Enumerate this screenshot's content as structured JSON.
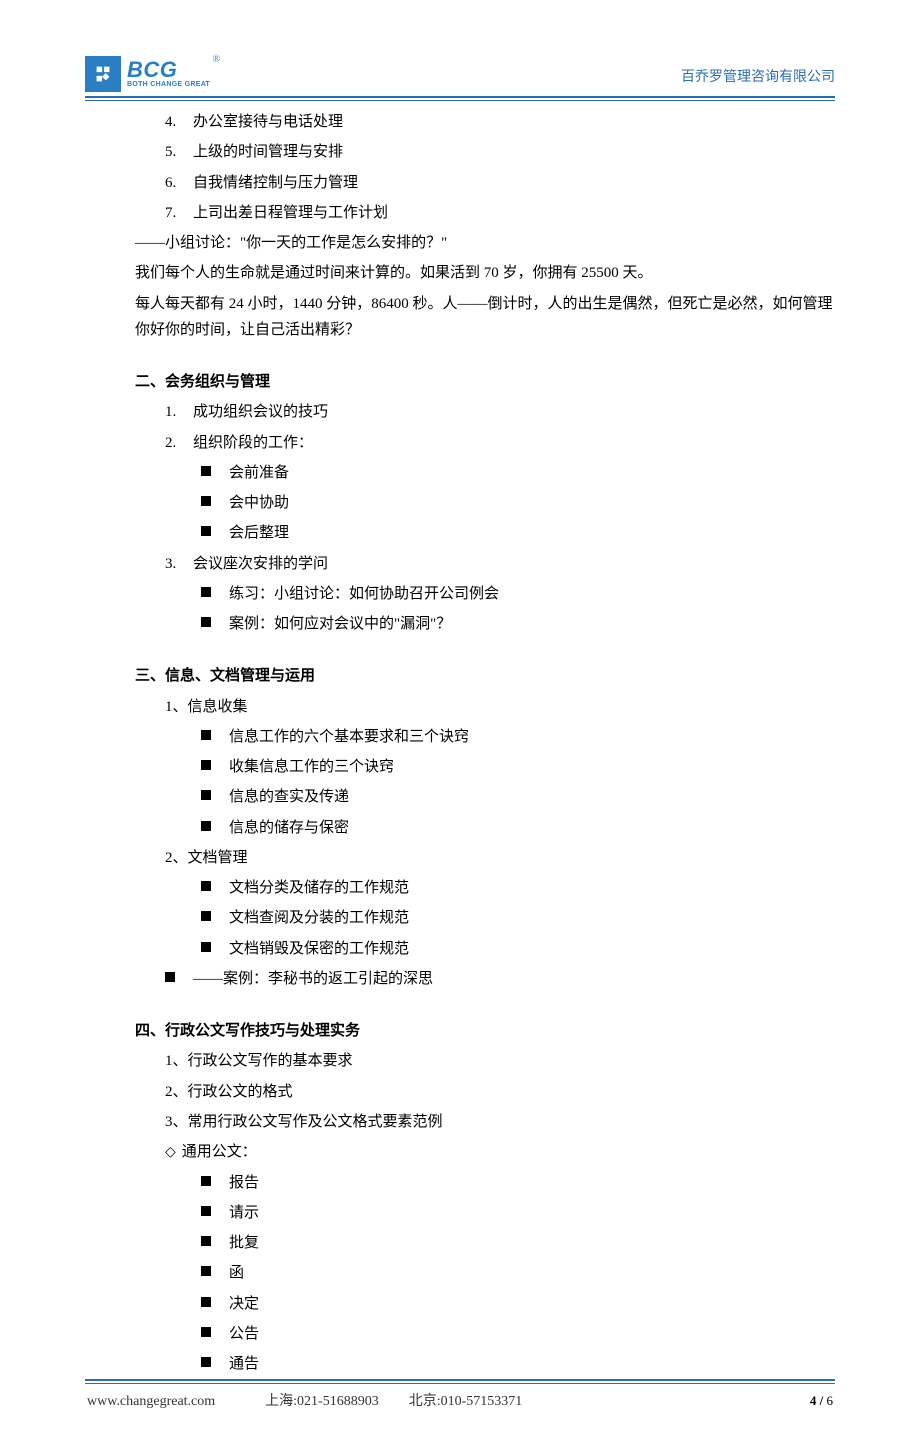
{
  "header": {
    "logo_text": "BCG",
    "logo_sub": "BOTH CHANGE GREAT",
    "logo_reg": "®",
    "company": "百乔罗管理咨询有限公司"
  },
  "section1": {
    "items": [
      "办公室接待与电话处理",
      "上级的时间管理与安排",
      "自我情绪控制与压力管理",
      "上司出差日程管理与工作计划"
    ],
    "para1": "——小组讨论：\"你一天的工作是怎么安排的？\"",
    "para2": "我们每个人的生命就是通过时间来计算的。如果活到 70 岁，你拥有 25500 天。",
    "para3": "每人每天都有 24 小时，1440 分钟，86400 秒。人——倒计时，人的出生是偶然，但死亡是必然，如何管理你好你的时间，让自己活出精彩？"
  },
  "section2": {
    "title": "二、会务组织与管理",
    "n1": "成功组织会议的技巧",
    "n2": "组织阶段的工作：",
    "sub2": [
      "会前准备",
      "会中协助",
      "会后整理"
    ],
    "n3": "会议座次安排的学问",
    "sub3": [
      "练习：小组讨论：如何协助召开公司例会",
      "案例：如何应对会议中的\"漏洞\"？"
    ]
  },
  "section3": {
    "title": "三、信息、文档管理与运用",
    "g1": "1、信息收集",
    "g1_items": [
      "信息工作的六个基本要求和三个诀窍",
      "收集信息工作的三个诀窍",
      "信息的查实及传递",
      "信息的储存与保密"
    ],
    "g2": "2、文档管理",
    "g2_items": [
      "文档分类及储存的工作规范",
      "文档查阅及分装的工作规范",
      "文档销毁及保密的工作规范"
    ],
    "case": "——案例：李秘书的返工引起的深思"
  },
  "section4": {
    "title": "四、行政公文写作技巧与处理实务",
    "n1": "1、行政公文写作的基本要求",
    "n2": "2、行政公文的格式",
    "n3": "3、常用行政公文写作及公文格式要素范例",
    "general": "通用公文：",
    "general_items": [
      "报告",
      "请示",
      "批复",
      "函",
      "决定",
      "公告",
      "通告"
    ]
  },
  "footer": {
    "web": "www.changegreat.com",
    "sh": "上海:021-51688903",
    "bj": "北京:010-57153371",
    "page_cur": "4",
    "page_sep": " / ",
    "page_tot": "6"
  }
}
